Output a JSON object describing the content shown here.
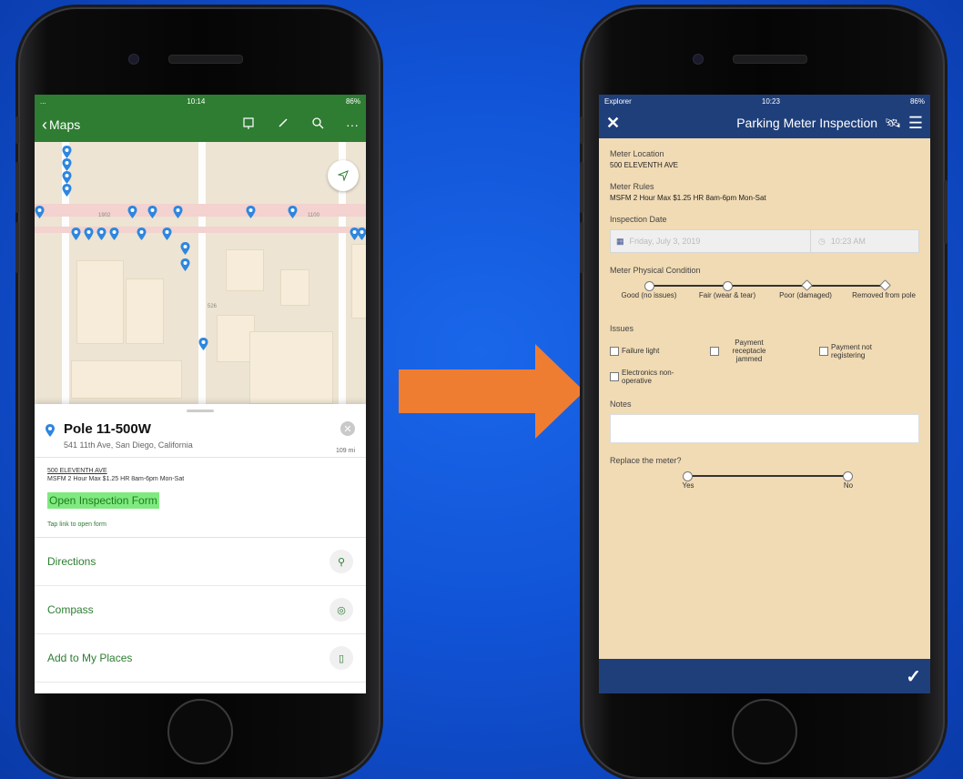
{
  "left_phone": {
    "status": {
      "carrier": "...",
      "time": "10:14",
      "battery": "86%"
    },
    "nav": {
      "back_label": "Maps",
      "icons": [
        "bookmark-icon",
        "pencil-icon",
        "search-icon",
        "more-icon"
      ]
    },
    "map": {
      "street_labels": [
        "1902",
        "1100",
        "526"
      ]
    },
    "poi": {
      "title": "Pole 11-500W",
      "address": "541 11th Ave, San Diego, California",
      "distance": "109 mi",
      "description_line1": "500 ELEVENTH AVE",
      "description_line2": "MSFM 2 Hour Max $1.25 HR 8am-6pm Mon-Sat",
      "open_form_link": "Open Inspection Form",
      "tap_hint": "Tap link to open form"
    },
    "actions": [
      {
        "label": "Directions",
        "icon": "directions-icon"
      },
      {
        "label": "Compass",
        "icon": "compass-icon"
      },
      {
        "label": "Add to My Places",
        "icon": "bookmark-icon"
      }
    ]
  },
  "right_phone": {
    "status": {
      "carrier": "Explorer",
      "time": "10:23",
      "battery": "86%"
    },
    "header": {
      "title": "Parking Meter Inspection"
    },
    "fields": {
      "location_label": "Meter Location",
      "location_value": "500 ELEVENTH AVE",
      "rules_label": "Meter Rules",
      "rules_value": "MSFM 2 Hour Max $1.25 HR 8am-6pm Mon-Sat",
      "date_label": "Inspection Date",
      "date_value": "Friday, July 3, 2019",
      "time_value": "10:23 AM",
      "condition_label": "Meter Physical Condition",
      "condition_options": [
        "Good (no issues)",
        "Fair (wear & tear)",
        "Poor (damaged)",
        "Removed from pole"
      ],
      "issues_label": "Issues",
      "issue_options": [
        "Failure light",
        "Payment receptacle jammed",
        "Payment not registering",
        "Electronics non-operative"
      ],
      "notes_label": "Notes",
      "replace_label": "Replace the meter?",
      "replace_options": [
        "Yes",
        "No"
      ]
    }
  },
  "colors": {
    "arrow": "#ee7d32",
    "map_green": "#2e7d32",
    "form_blue": "#1f3f7a",
    "form_bg": "#f1dbb4"
  }
}
